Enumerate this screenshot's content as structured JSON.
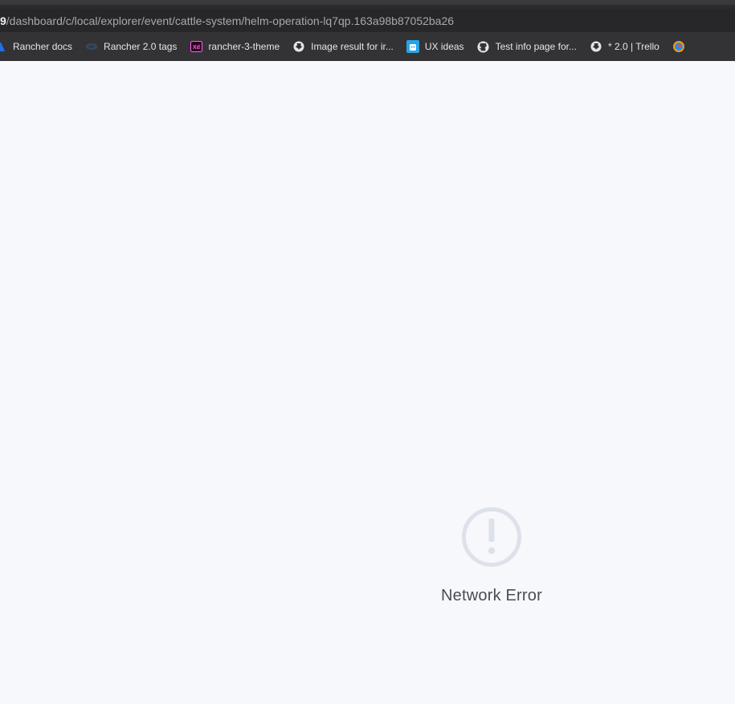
{
  "browser": {
    "url_prefix": "9",
    "url_rest": "/dashboard/c/local/explorer/event/cattle-system/helm-operation-lq7qp.163a98b87052ba26",
    "bookmarks": [
      {
        "label": "Rancher docs",
        "icon": "rancher-logo-icon"
      },
      {
        "label": "Rancher 2.0 tags",
        "icon": "rancher-cow-icon"
      },
      {
        "label": "rancher-3-theme",
        "icon": "adobe-xd-icon"
      },
      {
        "label": "Image result for ir...",
        "icon": "globe-icon"
      },
      {
        "label": "UX ideas",
        "icon": "robot-icon"
      },
      {
        "label": "Test info page for...",
        "icon": "github-icon"
      },
      {
        "label": "* 2.0 | Trello",
        "icon": "globe-icon"
      }
    ]
  },
  "main": {
    "error_message": "Network Error",
    "error_icon": "exclamation-circle-icon"
  },
  "colors": {
    "background": "#f6f8fb",
    "error_icon": "#dde1ea",
    "error_text": "#4a4d55"
  }
}
